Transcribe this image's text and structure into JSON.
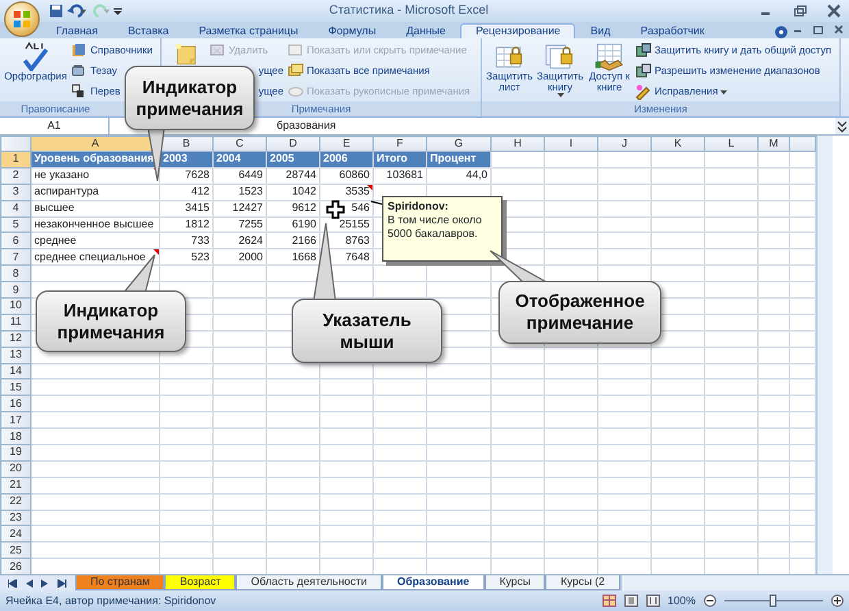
{
  "window": {
    "title": "Статистика - Microsoft Excel"
  },
  "tabs": [
    {
      "label": "Главная",
      "selected": false
    },
    {
      "label": "Вставка",
      "selected": false
    },
    {
      "label": "Разметка страницы",
      "selected": false
    },
    {
      "label": "Формулы",
      "selected": false
    },
    {
      "label": "Данные",
      "selected": false
    },
    {
      "label": "Рецензирование",
      "selected": true
    },
    {
      "label": "Вид",
      "selected": false
    },
    {
      "label": "Разработчик",
      "selected": false
    }
  ],
  "ribbon": [
    {
      "label": "Правописание",
      "items": [
        {
          "kind": "large",
          "label": "Орфография",
          "disabled": false,
          "dropdown": false
        },
        {
          "kind": "small",
          "label": "Справочники",
          "disabled": false,
          "dropdown": false
        },
        {
          "kind": "small",
          "label": "Тезау",
          "disabled": false,
          "dropdown": false
        },
        {
          "kind": "small",
          "label": "Перев",
          "disabled": false,
          "dropdown": false
        }
      ]
    },
    {
      "label": "Примечания",
      "items": [
        {
          "kind": "large"
        },
        {
          "kind": "small",
          "label": "Удалить",
          "disabled": true,
          "dropdown": false
        },
        {
          "kind": "cut",
          "label": "ущее",
          "disabled": false,
          "dropdown": false
        },
        {
          "kind": "cut",
          "label": "ущее",
          "disabled": false,
          "dropdown": false
        },
        {
          "kind": "small",
          "label": "Показать или скрыть примечание",
          "disabled": true,
          "dropdown": false
        },
        {
          "kind": "small",
          "label": "Показать все примечания",
          "disabled": false,
          "dropdown": false
        },
        {
          "kind": "small",
          "label": "Показать рукописные примечания",
          "disabled": true,
          "dropdown": false
        }
      ]
    },
    {
      "label": "Изменения",
      "items": [
        {
          "kind": "large",
          "label": "Защитить лист",
          "disabled": false,
          "dropdown": false
        },
        {
          "kind": "large",
          "label": "Защитить книгу",
          "disabled": false,
          "dropdown": true
        },
        {
          "kind": "large",
          "label": "Доступ к книге",
          "disabled": false,
          "dropdown": false
        },
        {
          "kind": "small",
          "label": "Защитить книгу и дать общий доступ",
          "disabled": false,
          "dropdown": false
        },
        {
          "kind": "small",
          "label": "Разрешить изменение диапазонов",
          "disabled": false,
          "dropdown": false
        },
        {
          "kind": "small",
          "label": "Исправления",
          "disabled": false,
          "dropdown": true
        }
      ]
    }
  ],
  "name_box": "A1",
  "formula": "бразования",
  "columns": [
    "A",
    "B",
    "C",
    "D",
    "E",
    "F",
    "G",
    "H",
    "I",
    "J",
    "K",
    "L",
    "M"
  ],
  "header_row": {
    "number": "1",
    "cells": [
      {
        "text": "Уровень образования"
      },
      {
        "text": "2003"
      },
      {
        "text": "2004"
      },
      {
        "text": "2005"
      },
      {
        "text": "2006"
      },
      {
        "text": "Итого"
      },
      {
        "text": "Процент"
      }
    ]
  },
  "rows": [
    {
      "number": "2",
      "cells": [
        {
          "text": "не указано",
          "comment": true
        },
        {
          "text": "7628"
        },
        {
          "text": "6449"
        },
        {
          "text": "28744"
        },
        {
          "text": "60860"
        },
        {
          "text": "103681"
        },
        {
          "text": "44,0"
        }
      ]
    },
    {
      "number": "3",
      "cells": [
        {
          "text": "аспирантура"
        },
        {
          "text": "412"
        },
        {
          "text": "1523"
        },
        {
          "text": "1042"
        },
        {
          "text": "3535",
          "comment": true
        }
      ]
    },
    {
      "number": "4",
      "cells": [
        {
          "text": "высшее"
        },
        {
          "text": "3415"
        },
        {
          "text": "12427"
        },
        {
          "text": "9612"
        },
        {
          "text": "546",
          "pointer": true
        }
      ]
    },
    {
      "number": "5",
      "cells": [
        {
          "text": "незаконченное высшее"
        },
        {
          "text": "1812"
        },
        {
          "text": "7255"
        },
        {
          "text": "6190"
        },
        {
          "text": "25155"
        }
      ]
    },
    {
      "number": "6",
      "cells": [
        {
          "text": "среднее"
        },
        {
          "text": "733"
        },
        {
          "text": "2624"
        },
        {
          "text": "2166"
        },
        {
          "text": "8763"
        }
      ]
    },
    {
      "number": "7",
      "cells": [
        {
          "text": "среднее специальное",
          "comment": true
        },
        {
          "text": "523"
        },
        {
          "text": "2000"
        },
        {
          "text": "1668"
        },
        {
          "text": "7648"
        }
      ]
    },
    {
      "number": "8",
      "cells": []
    },
    {
      "number": "9",
      "cells": []
    },
    {
      "number": "10",
      "cells": []
    },
    {
      "number": "11",
      "cells": []
    },
    {
      "number": "12",
      "cells": []
    },
    {
      "number": "13",
      "cells": []
    },
    {
      "number": "14",
      "cells": []
    },
    {
      "number": "15",
      "cells": []
    },
    {
      "number": "16",
      "cells": []
    },
    {
      "number": "17",
      "cells": []
    },
    {
      "number": "18",
      "cells": []
    },
    {
      "number": "19",
      "cells": []
    },
    {
      "number": "20",
      "cells": []
    },
    {
      "number": "21",
      "cells": []
    },
    {
      "number": "22",
      "cells": []
    },
    {
      "number": "23",
      "cells": []
    },
    {
      "number": "24",
      "cells": []
    },
    {
      "number": "25",
      "cells": []
    },
    {
      "number": "26",
      "cells": []
    }
  ],
  "comment": {
    "author": "Spiridonov:",
    "text": "В том числе около 5000 бакалавров."
  },
  "callouts": [
    "Индикатор примечания",
    "Индикатор примечания",
    "Указатель мыши",
    "Отображенное примечание"
  ],
  "sheet_tabs": [
    {
      "label": "По странам",
      "selected": false,
      "color": "#f07f1e"
    },
    {
      "label": "Возраст",
      "selected": false,
      "color": "#ffff00"
    },
    {
      "label": "Область деятельности",
      "selected": false
    },
    {
      "label": "Образование",
      "selected": true
    },
    {
      "label": "Курсы",
      "selected": false
    },
    {
      "label": "Курсы (2",
      "selected": false
    }
  ],
  "status_bar": {
    "text": "Ячейка E4, автор примечания: Spiridonov",
    "zoom": "100%",
    "zoom_slider": {
      "level": 0.5
    }
  }
}
